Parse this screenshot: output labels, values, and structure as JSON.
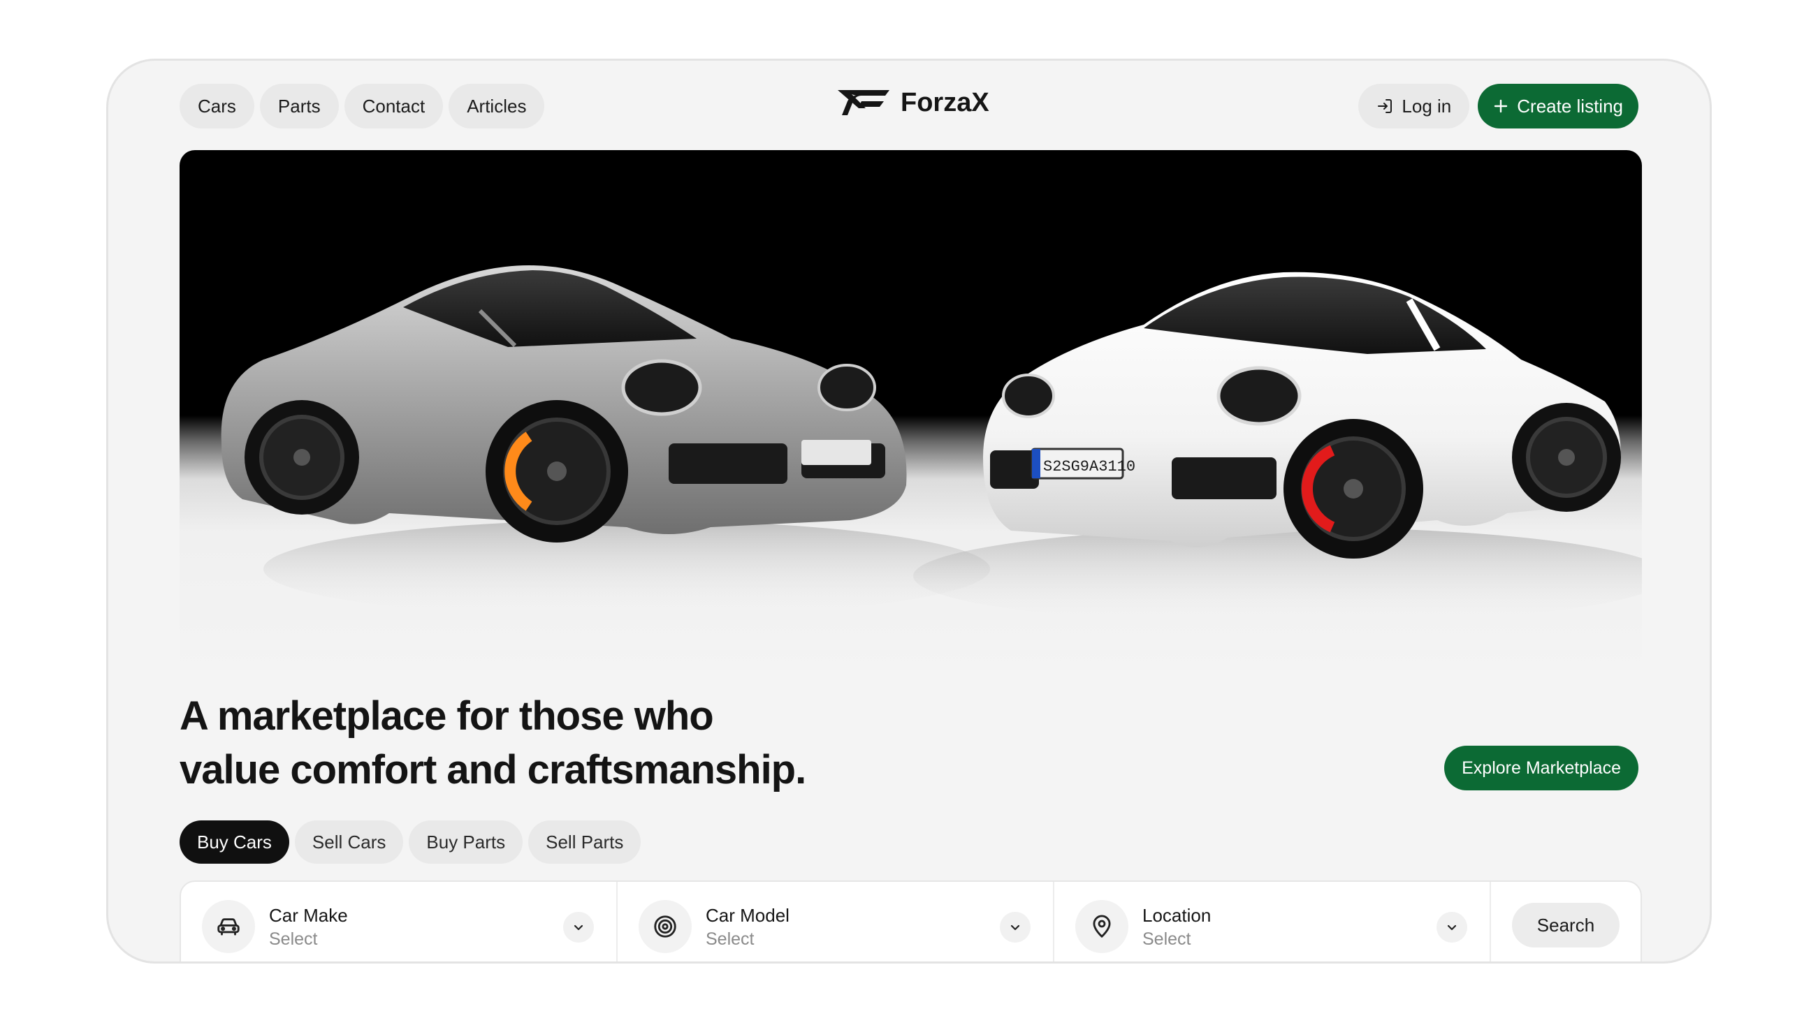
{
  "nav": {
    "items": [
      {
        "label": "Cars"
      },
      {
        "label": "Parts"
      },
      {
        "label": "Contact"
      },
      {
        "label": "Articles"
      }
    ],
    "login_label": "Log in",
    "create_label": "Create listing"
  },
  "brand": {
    "name": "ForzaX"
  },
  "hero": {
    "headline_line1": "A marketplace for those who",
    "headline_line2": "value comfort and craftsmanship.",
    "explore_label": "Explore Marketplace",
    "plate_text": "S2SG9A3110"
  },
  "tabs": [
    {
      "label": "Buy Cars",
      "active": true
    },
    {
      "label": "Sell Cars",
      "active": false
    },
    {
      "label": "Buy Parts",
      "active": false
    },
    {
      "label": "Sell Parts",
      "active": false
    }
  ],
  "search": {
    "fields": [
      {
        "label": "Car Make",
        "value": "Select",
        "icon": "car-icon"
      },
      {
        "label": "Car Model",
        "value": "Select",
        "icon": "target-icon"
      },
      {
        "label": "Location",
        "value": "Select",
        "icon": "map-pin-icon"
      }
    ],
    "button_label": "Search"
  },
  "colors": {
    "accent": "#0c6a34",
    "active_tab": "#101010",
    "background": "#f4f4f4"
  }
}
